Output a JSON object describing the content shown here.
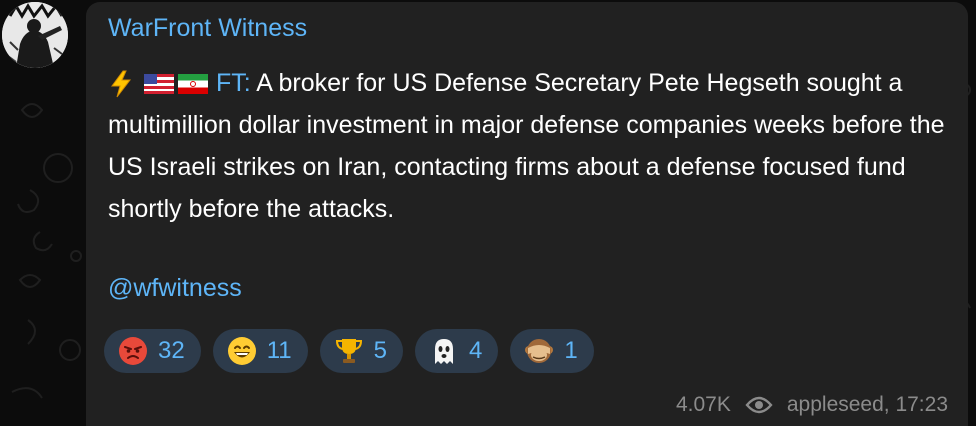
{
  "channel": {
    "name": "WarFront Witness"
  },
  "message": {
    "source_label": "FT:",
    "text": " A broker for US Defense Secretary Pete Hegseth sought a multimillion dollar investment in major defense companies weeks before the US Israeli strikes on Iran, contacting firms about a defense focused fund shortly before the attacks.",
    "mention": "@wfwitness",
    "icons": [
      "lightning-icon",
      "us-flag-icon",
      "iran-flag-icon"
    ]
  },
  "reactions": [
    {
      "icon": "angry-face-icon",
      "count": "32"
    },
    {
      "icon": "grinning-face-icon",
      "count": "11"
    },
    {
      "icon": "trophy-icon",
      "count": "5"
    },
    {
      "icon": "ghost-icon",
      "count": "4"
    },
    {
      "icon": "see-no-evil-monkey-icon",
      "count": "1"
    }
  ],
  "meta": {
    "views": "4.07K",
    "signature": "appleseed, 17:23"
  },
  "colors": {
    "accent": "#5eb5f7",
    "bubble": "#212121",
    "reaction_bg": "#2d3b4b",
    "meta_text": "#8b8b8b"
  }
}
